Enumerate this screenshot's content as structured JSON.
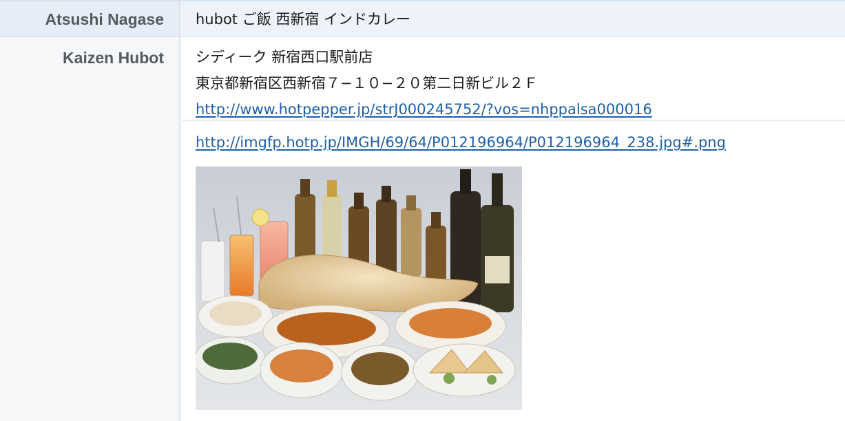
{
  "messages": [
    {
      "sender": "Atsushi Nagase",
      "text": "hubot ご飯 西新宿 インドカレー"
    },
    {
      "sender": "Kaizen Hubot",
      "lines": [
        "シディーク 新宿西口駅前店",
        "東京都新宿区西新宿７−１０−２０第二日新ビル２Ｆ"
      ],
      "links": [
        "http://www.hotpepper.jp/strJ000245752/?vos=nhppalsa000016",
        "http://imgfp.hotp.jp/IMGH/69/64/P012196964/P012196964_238.jpg#.png"
      ],
      "image": {
        "alt": "restaurant-food-photo",
        "colors": {
          "background": "#d9dde2",
          "naan": "#e8d2a8",
          "bottle_dark": "#3a3328",
          "curry": "#d08a5a"
        }
      }
    }
  ]
}
